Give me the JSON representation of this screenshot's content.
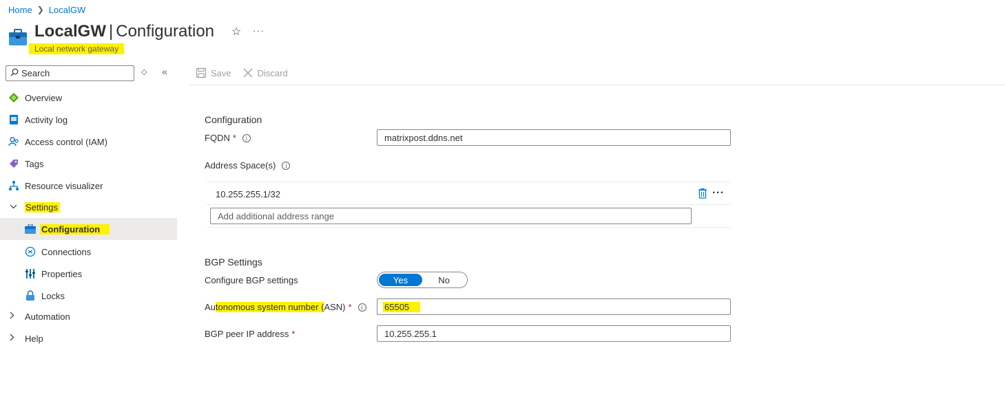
{
  "breadcrumb": {
    "home": "Home",
    "current": "LocalGW"
  },
  "header": {
    "resource_name": "LocalGW",
    "separator": "|",
    "page": "Configuration",
    "subtitle": "Local network gateway",
    "favorite_icon": "star-icon",
    "more_icon": "ellipsis-icon"
  },
  "search": {
    "placeholder": "Search"
  },
  "sidebar": {
    "items": [
      {
        "label": "Overview",
        "icon": "overview-icon"
      },
      {
        "label": "Activity log",
        "icon": "activity-log-icon"
      },
      {
        "label": "Access control (IAM)",
        "icon": "iam-icon"
      },
      {
        "label": "Tags",
        "icon": "tag-icon"
      },
      {
        "label": "Resource visualizer",
        "icon": "visualizer-icon"
      },
      {
        "label": "Settings",
        "expanded": true
      },
      {
        "label": "Configuration",
        "icon": "gateway-icon",
        "selected": true
      },
      {
        "label": "Connections",
        "icon": "connections-icon"
      },
      {
        "label": "Properties",
        "icon": "properties-icon"
      },
      {
        "label": "Locks",
        "icon": "lock-icon"
      },
      {
        "label": "Automation",
        "expanded": false
      },
      {
        "label": "Help",
        "expanded": false
      }
    ]
  },
  "toolbar": {
    "save": "Save",
    "discard": "Discard"
  },
  "form": {
    "section_configuration": "Configuration",
    "fqdn_label": "FQDN",
    "fqdn_value": "matrixpost.ddns.net",
    "address_space_label": "Address Space(s)",
    "address_space_value": "10.255.255.1/32",
    "add_range_placeholder": "Add additional address range",
    "section_bgp": "BGP Settings",
    "configure_bgp_label": "Configure BGP settings",
    "toggle_yes": "Yes",
    "toggle_no": "No",
    "toggle_selected": "Yes",
    "asn_label_prefix": "Au",
    "asn_label_highlight": "tonomous system number (",
    "asn_label_suffix": "ASN)",
    "asn_value": "65505",
    "bgp_peer_label": "BGP peer IP address",
    "bgp_peer_value": "10.255.255.1",
    "required_mark": "*"
  },
  "colors": {
    "accent": "#0078d4",
    "highlight": "#fff200",
    "required": "#a4262c"
  }
}
